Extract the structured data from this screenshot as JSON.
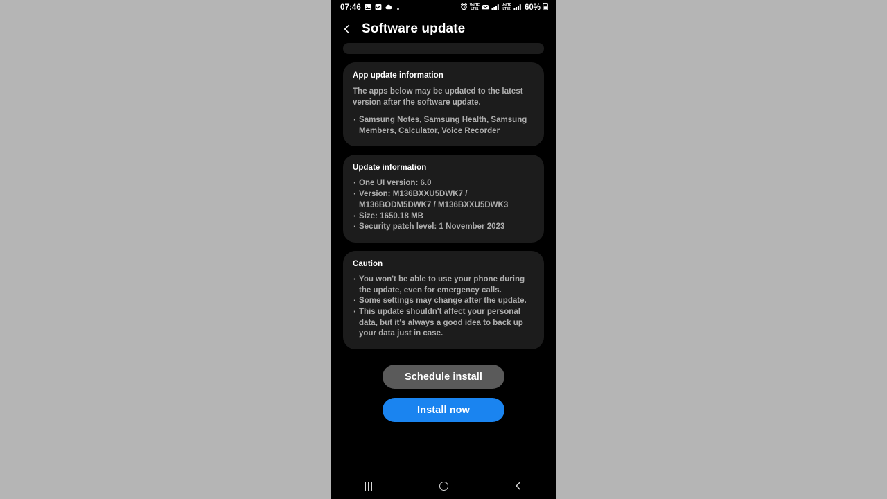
{
  "status_bar": {
    "time": "07:46",
    "left_icons": [
      "photo-icon",
      "checkbox-task-icon",
      "cloud-icon",
      "dot-icon"
    ],
    "right_icons": [
      "alarm-icon",
      "volte-lte1-icon",
      "voicemail-icon",
      "signal-bars-1-icon",
      "volte-lte2-icon",
      "signal-bars-2-icon"
    ],
    "volte_1_label_top": "VoLTE",
    "volte_1_label_bottom": "LTE1",
    "volte_2_label_top": "VoLTE",
    "volte_2_label_bottom": "LTE2",
    "battery_percent": "60%",
    "battery_icon": "battery-icon"
  },
  "app_bar": {
    "back_icon": "back-chevron-icon",
    "title": "Software update"
  },
  "cards": {
    "app_update": {
      "title": "App update information",
      "description": "The apps below may be updated to the latest version after the software update.",
      "bullets": [
        "Samsung Notes, Samsung Health, Samsung Members, Calculator, Voice Recorder"
      ]
    },
    "update_info": {
      "title": "Update information",
      "bullets": [
        "One UI version: 6.0",
        "Version: M136BXXU5DWK7 / M136BODM5DWK7 / M136BXXU5DWK3",
        "Size: 1650.18 MB",
        "Security patch level: 1 November 2023"
      ]
    },
    "caution": {
      "title": "Caution",
      "bullets": [
        "You won't be able to use your phone during the update, even for emergency calls.",
        "Some settings may change after the update.",
        "This update shouldn't affect your personal data, but it's always a good idea to back up your data just in case."
      ]
    }
  },
  "buttons": {
    "schedule_install": "Schedule install",
    "install_now": "Install now"
  },
  "nav_bar": {
    "recents": "recents-icon",
    "home": "home-icon",
    "back": "back-icon"
  },
  "colors": {
    "backdrop": "#b5b5b5",
    "screen_bg": "#000000",
    "card_bg": "#1c1c1c",
    "primary_button": "#1a84f0",
    "secondary_button": "#5a5a5a",
    "title_text": "#ffffff",
    "body_text": "#aeaeae"
  }
}
